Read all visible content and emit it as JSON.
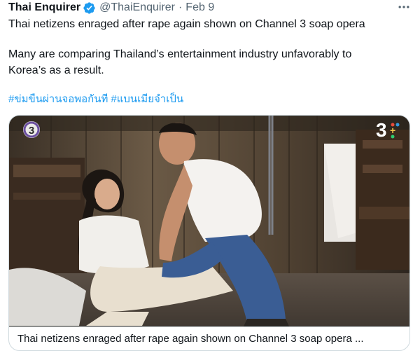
{
  "tweet": {
    "author_name": "Thai Enquirer",
    "handle": "@ThaiEnquirer",
    "separator": "·",
    "date": "Feb 9",
    "more_icon": "more-horizontal-icon",
    "verified_icon": "verified-badge-icon",
    "text_line1": "Thai netizens enraged after rape again shown on Channel 3 soap opera",
    "text_line2": "Many are comparing Thailand’s entertainment industry unfavorably to",
    "text_line3": "Korea’s as a result.",
    "hashtags": [
      "#ข่มขืนผ่านจอพอกันที",
      "#แบนเมียจำเป็น"
    ],
    "link_color": "#1d9bf0"
  },
  "card": {
    "caption": "Thai netizens enraged after rape again shown on Channel 3 soap opera ...",
    "logo_left_label": "3",
    "logo_right_label": "3",
    "logo_right_plus": "+"
  }
}
